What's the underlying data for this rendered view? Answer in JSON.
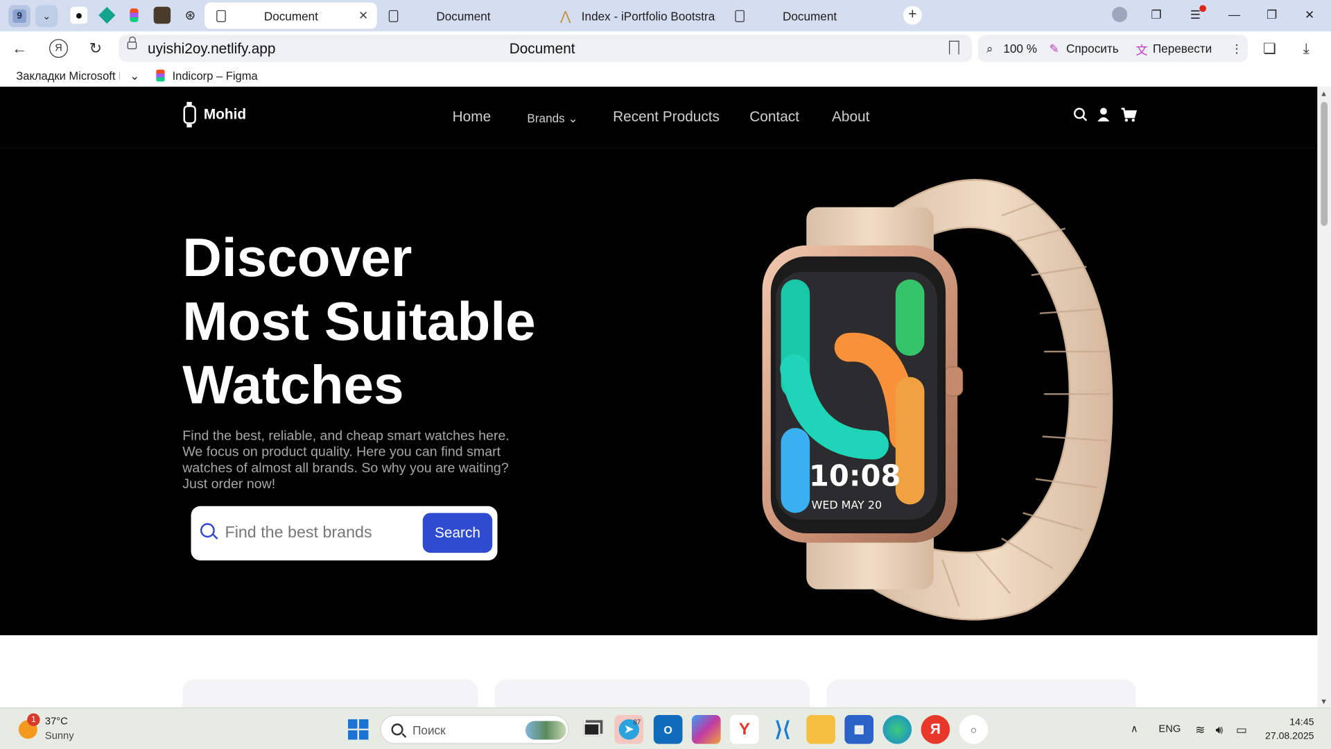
{
  "browser": {
    "tab_count": "9",
    "tabs": [
      {
        "label": "Document"
      },
      {
        "label": "Document"
      },
      {
        "label": "Index - iPortfolio Bootstrap"
      },
      {
        "label": "Document"
      }
    ],
    "url": "uyishi2oy.netlify.app",
    "page_title": "Document",
    "zoom": "100 %",
    "ask_label": "Спросить",
    "translate_label": "Перевести",
    "bookmarks": [
      {
        "label": "Закладки Microsoft E"
      },
      {
        "label": "Indicorp – Figma"
      }
    ]
  },
  "site": {
    "logo": "Mohid",
    "nav": [
      {
        "label": "Home"
      },
      {
        "label": "Brands"
      },
      {
        "label": "Recent Products"
      },
      {
        "label": "Contact"
      },
      {
        "label": "About"
      }
    ],
    "hero": {
      "title_lines": [
        "Discover",
        "Most Suitable",
        "Watches"
      ],
      "description": "Find the best, reliable, and cheap smart watches here. We focus on product quality. Here you can find smart watches of almost all brands. So why you are waiting? Just order now!",
      "search_placeholder": "Find the best brands",
      "search_button": "Search"
    },
    "watch_face": {
      "time": "10:08",
      "date": "WED  MAY 20"
    }
  },
  "taskbar": {
    "weather_badge": "1",
    "temperature": "37°C",
    "condition": "Sunny",
    "search_label": "Поиск",
    "telegram_badge": "87",
    "language": "ENG",
    "time": "14:45",
    "date": "27.08.2025"
  },
  "colors": {
    "accent": "#2f4cd0",
    "nav_bg": "#000000",
    "band": "#ecd5bd",
    "case": "#d6a488"
  }
}
